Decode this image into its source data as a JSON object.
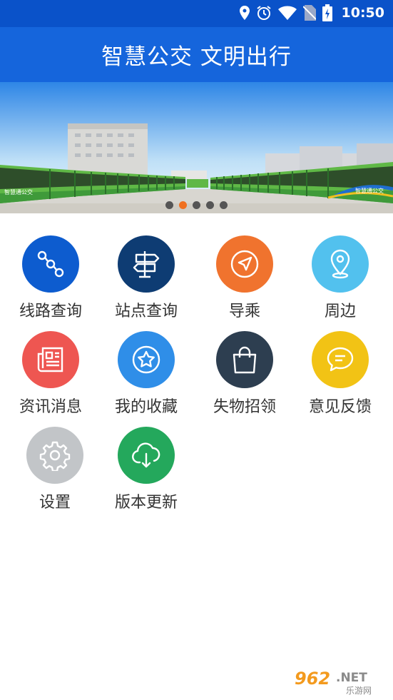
{
  "status_bar": {
    "time": "10:50",
    "icons": [
      "location-icon",
      "alarm-icon",
      "wifi-icon",
      "no-sim-icon",
      "battery-charging-icon"
    ]
  },
  "header": {
    "title": "智慧公交 文明出行"
  },
  "banner": {
    "bus_livery_text": "智慧通公交",
    "slides": 5,
    "active_slide": 1
  },
  "menu": {
    "items": [
      {
        "label": "线路查询",
        "icon": "route-icon",
        "color": "#0d5ccf"
      },
      {
        "label": "站点查询",
        "icon": "signpost-icon",
        "color": "#0e3c73"
      },
      {
        "label": "导乘",
        "icon": "compass-navigation-icon",
        "color": "#f0732e"
      },
      {
        "label": "周边",
        "icon": "location-pin-icon",
        "color": "#52c1ee"
      },
      {
        "label": "资讯消息",
        "icon": "newspaper-icon",
        "color": "#ee5651"
      },
      {
        "label": "我的收藏",
        "icon": "star-icon",
        "color": "#2f8ee8"
      },
      {
        "label": "失物招领",
        "icon": "shopping-bag-icon",
        "color": "#2d3e50"
      },
      {
        "label": "意见反馈",
        "icon": "chat-bubble-icon",
        "color": "#f2c315"
      },
      {
        "label": "设置",
        "icon": "gear-icon",
        "color": "#c2c5c8"
      },
      {
        "label": "版本更新",
        "icon": "cloud-download-icon",
        "color": "#24a85c"
      }
    ]
  },
  "watermark": {
    "number": "962",
    "suffix": ".NET",
    "subtitle": "乐游网"
  }
}
